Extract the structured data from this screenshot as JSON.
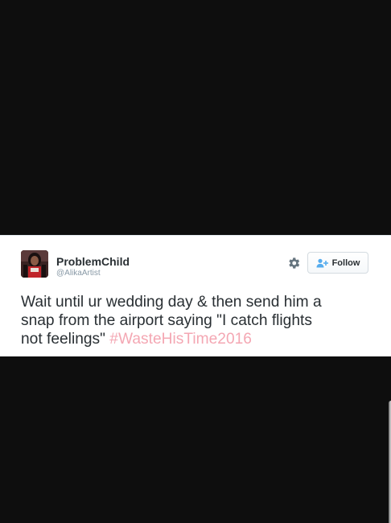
{
  "tweet": {
    "author": {
      "display_name": "ProblemChild",
      "handle": "@AlikaArtist"
    },
    "follow_label": "Follow",
    "text_lines": [
      "Wait until ur wedding day & then send him a",
      "snap from the airport saying \"I catch flights",
      "not feelings\" "
    ],
    "hashtag": "#WasteHisTime2016",
    "icons": {
      "settings": "gear-icon",
      "follow": "add-person-icon"
    }
  },
  "colors": {
    "background": "#0e0e0e",
    "card": "#ffffff",
    "hashtag": "#f4a7b3",
    "follow_icon": "#55acee"
  }
}
